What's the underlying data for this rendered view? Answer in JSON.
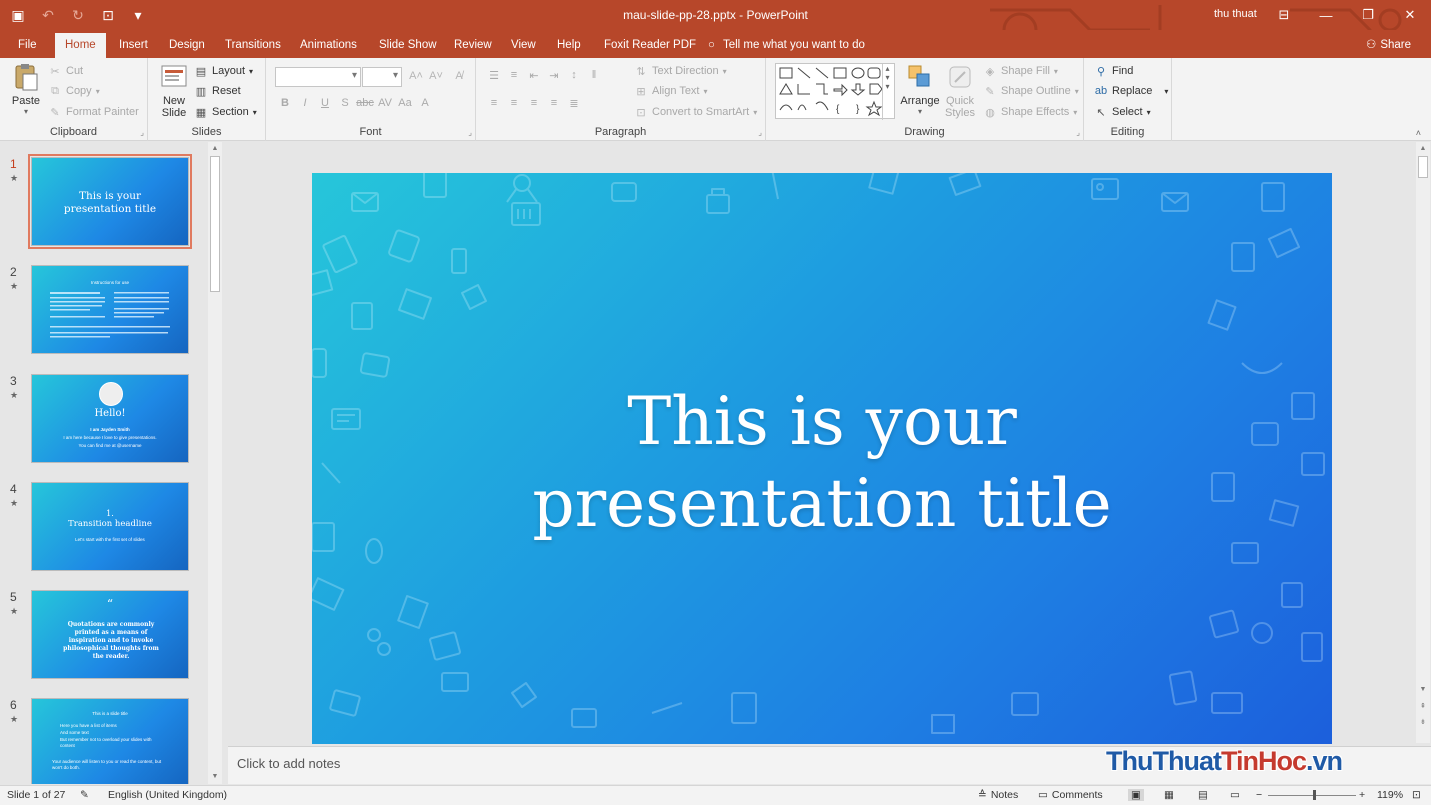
{
  "window": {
    "document_title": "mau-slide-pp-28.pptx",
    "separator": " - ",
    "app_name": "PowerPoint",
    "user_name": "thu thuat"
  },
  "tabs": [
    {
      "label": "File"
    },
    {
      "label": "Home"
    },
    {
      "label": "Insert"
    },
    {
      "label": "Design"
    },
    {
      "label": "Transitions"
    },
    {
      "label": "Animations"
    },
    {
      "label": "Slide Show"
    },
    {
      "label": "Review"
    },
    {
      "label": "View"
    },
    {
      "label": "Help"
    },
    {
      "label": "Foxit Reader PDF"
    }
  ],
  "tell_me": "Tell me what you want to do",
  "share": "Share",
  "ribbon": {
    "clipboard": {
      "paste": "Paste",
      "cut": "Cut",
      "copy": "Copy",
      "format_painter": "Format Painter",
      "label": "Clipboard"
    },
    "slides": {
      "new_slide_1": "New",
      "new_slide_2": "Slide",
      "layout": "Layout",
      "reset": "Reset",
      "section": "Section",
      "label": "Slides"
    },
    "font": {
      "label": "Font"
    },
    "paragraph": {
      "text_direction": "Text Direction",
      "align_text": "Align Text",
      "convert_smartart": "Convert to SmartArt",
      "label": "Paragraph"
    },
    "drawing": {
      "arrange": "Arrange",
      "quick_styles_1": "Quick",
      "quick_styles_2": "Styles",
      "shape_fill": "Shape Fill",
      "shape_outline": "Shape Outline",
      "shape_effects": "Shape Effects",
      "label": "Drawing"
    },
    "editing": {
      "find": "Find",
      "replace": "Replace",
      "select": "Select",
      "label": "Editing"
    }
  },
  "thumbnails": [
    {
      "num": "1",
      "title": "This is your presentation title"
    },
    {
      "num": "2",
      "heading": "Instructions for use"
    },
    {
      "num": "3",
      "hello": "Hello!",
      "name": "I am Jayden Smith",
      "line1": "I am here because I love to give presentations.",
      "line2": "You can find me at @username"
    },
    {
      "num": "4",
      "number": "1.",
      "headline": "Transition headline",
      "sub": "Let's start with the first set of slides"
    },
    {
      "num": "5",
      "quote_mark": "“",
      "quote": "Quotations are commonly printed as a means of inspiration and to invoke philosophical thoughts from the reader."
    },
    {
      "num": "6",
      "title": "This is a slide title",
      "b1": "Here you have a list of items",
      "b2": "And some text",
      "b3": "But remember not to overload your slides with content",
      "p1": "Your audience will listen to you or read the content, but won't do both."
    }
  ],
  "slide": {
    "title_line1": "This is your",
    "title_line2": "presentation title"
  },
  "notes_placeholder": "Click to add notes",
  "watermark": {
    "part1": "ThuThuat",
    "part2": "TinHoc",
    "part3": ".vn"
  },
  "status": {
    "slide_counter": "Slide 1 of 27",
    "language": "English (United Kingdom)",
    "notes": "Notes",
    "comments": "Comments",
    "zoom": "119%"
  }
}
